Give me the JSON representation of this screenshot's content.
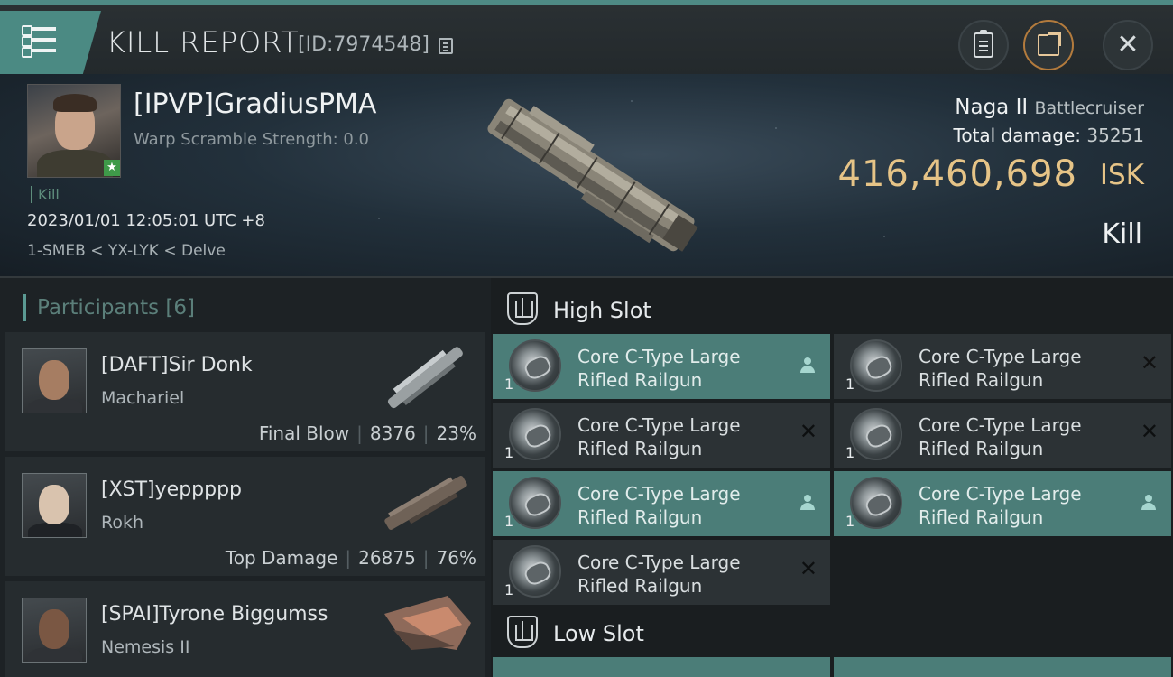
{
  "header": {
    "title": "KILL REPORT",
    "report_id": "[ID:7974548]"
  },
  "victim": {
    "name": "[IPVP]GradiusPMA",
    "warp_scramble": "Warp Scramble Strength: 0.0",
    "tag": "Kill",
    "datetime": "2023/01/01 12:05:01 UTC +8",
    "location": "1-SMEB < YX-LYK < Delve",
    "ship_name": "Naga II",
    "ship_class": "Battlecruiser",
    "total_damage_label": "Total damage:",
    "total_damage": "35251",
    "isk_value": "416,460,698",
    "isk_unit": "ISK",
    "result": "Kill"
  },
  "participants": {
    "header": "Participants",
    "count": "[6]",
    "rows": [
      {
        "name": "[DAFT]Sir Donk",
        "ship": "Machariel",
        "role": "Final Blow",
        "damage": "8376",
        "percent": "23%"
      },
      {
        "name": "[XST]yeppppp",
        "ship": "Rokh",
        "role": "Top Damage",
        "damage": "26875",
        "percent": "76%"
      },
      {
        "name": "[SPAI]Tyrone Biggumss",
        "ship": "Nemesis II"
      }
    ]
  },
  "fitting": {
    "high_slot_title": "High Slot",
    "low_slot_title": "Low Slot",
    "modules": [
      {
        "line1": "Core C-Type Large",
        "line2": "Rifled Railgun",
        "qty": "1",
        "state": "active"
      },
      {
        "line1": "Core C-Type Large",
        "line2": "Rifled Railgun",
        "qty": "1",
        "state": "destroyed"
      },
      {
        "line1": "Core C-Type Large",
        "line2": "Rifled Railgun",
        "qty": "1",
        "state": "destroyed"
      },
      {
        "line1": "Core C-Type Large",
        "line2": "Rifled Railgun",
        "qty": "1",
        "state": "destroyed"
      },
      {
        "line1": "Core C-Type Large",
        "line2": "Rifled Railgun",
        "qty": "1",
        "state": "active"
      },
      {
        "line1": "Core C-Type Large",
        "line2": "Rifled Railgun",
        "qty": "1",
        "state": "active"
      },
      {
        "line1": "Core C-Type Large",
        "line2": "Rifled Railgun",
        "qty": "1",
        "state": "destroyed"
      }
    ]
  },
  "colors": {
    "accent": "#4b8a83",
    "isk_gold": "#e6c487",
    "module_active": "#4b7d78"
  }
}
